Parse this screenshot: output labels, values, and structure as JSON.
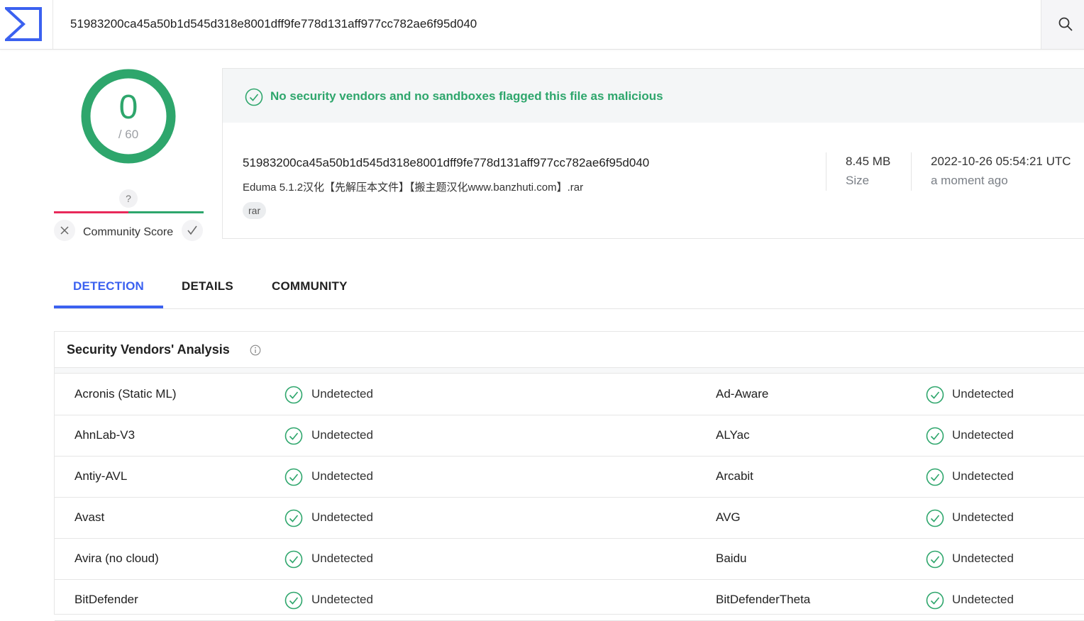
{
  "search": {
    "value": "51983200ca45a50b1d545d318e8001dff9fe778d131aff977cc782ae6f95d040"
  },
  "score": {
    "detections": "0",
    "total": "/ 60"
  },
  "community": {
    "question": "?",
    "label": "Community Score"
  },
  "summary": {
    "banner": "No security vendors and no sandboxes flagged this file as malicious",
    "hash": "51983200ca45a50b1d545d318e8001dff9fe778d131aff977cc782ae6f95d040",
    "filename": "Eduma 5.1.2汉化【先解压本文件】【搬主题汉化www.banzhuti.com】.rar",
    "tag": "rar",
    "size_value": "8.45 MB",
    "size_label": "Size",
    "date_value": "2022-10-26 05:54:21 UTC",
    "date_label": "a moment ago"
  },
  "tabs": [
    {
      "label": "DETECTION",
      "active": true
    },
    {
      "label": "DETAILS",
      "active": false
    },
    {
      "label": "COMMUNITY",
      "active": false
    }
  ],
  "vendors": {
    "title": "Security Vendors' Analysis",
    "rows": [
      {
        "left_name": "Acronis (Static ML)",
        "left_status": "Undetected",
        "right_name": "Ad-Aware",
        "right_status": "Undetected"
      },
      {
        "left_name": "AhnLab-V3",
        "left_status": "Undetected",
        "right_name": "ALYac",
        "right_status": "Undetected"
      },
      {
        "left_name": "Antiy-AVL",
        "left_status": "Undetected",
        "right_name": "Arcabit",
        "right_status": "Undetected"
      },
      {
        "left_name": "Avast",
        "left_status": "Undetected",
        "right_name": "AVG",
        "right_status": "Undetected"
      },
      {
        "left_name": "Avira (no cloud)",
        "left_status": "Undetected",
        "right_name": "Baidu",
        "right_status": "Undetected"
      },
      {
        "left_name": "BitDefender",
        "left_status": "Undetected",
        "right_name": "BitDefenderTheta",
        "right_status": "Undetected"
      }
    ]
  },
  "colors": {
    "accent": "#3b61f0",
    "safe": "#2ea66c",
    "danger": "#e8295a"
  }
}
